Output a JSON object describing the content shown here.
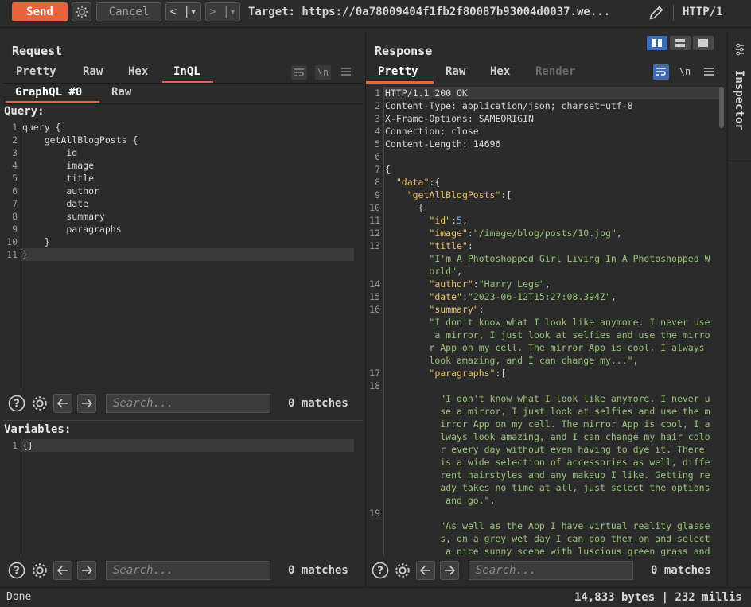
{
  "toolbar": {
    "send_label": "Send",
    "cancel_label": "Cancel",
    "back_label": "< |▾",
    "forward_label": "> |▾",
    "target_text": "Target: https://0a78009404f1fb2f80087b93004d0037.we...",
    "protocol": "HTTP/1"
  },
  "request": {
    "title": "Request",
    "tabs": [
      "Pretty",
      "Raw",
      "Hex",
      "InQL"
    ],
    "active_tab": "InQL",
    "subtabs": [
      "GraphQL #0",
      "Raw"
    ],
    "query_label": "Query:",
    "query_lines": [
      "query {",
      "    getAllBlogPosts {",
      "        id",
      "        image",
      "        title",
      "        author",
      "        date",
      "        summary",
      "        paragraphs",
      "    }",
      "}"
    ],
    "variables_label": "Variables:",
    "variables_lines": [
      "{}"
    ],
    "search_placeholder": "Search...",
    "matches": "0 matches"
  },
  "response": {
    "title": "Response",
    "tabs": [
      "Pretty",
      "Raw",
      "Hex",
      "Render"
    ],
    "active_tab": "Pretty",
    "search_placeholder": "Search...",
    "matches": "0 matches"
  },
  "inspector_label": "Inspector",
  "status": {
    "left": "Done",
    "right": "14,833 bytes | 232 millis"
  },
  "icons": [
    "settings-icon",
    "pencil-icon",
    "help-icon",
    "arrow-left-icon",
    "arrow-right-icon",
    "wrap-icon",
    "newline-icon",
    "menu-icon",
    "layout-icon"
  ],
  "colors": {
    "accent": "#e8643c",
    "background": "#2b2b2b",
    "key": "#e9c16b",
    "string": "#98c379",
    "number": "#6ea8e8",
    "toggle_active": "#3b6cb5"
  }
}
